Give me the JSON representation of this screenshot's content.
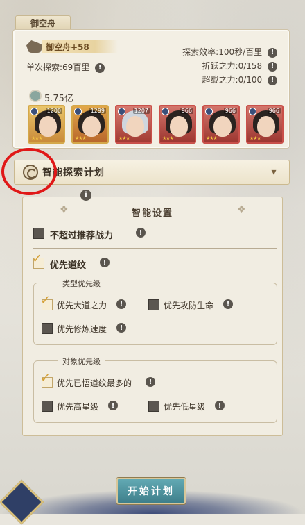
{
  "panel": {
    "title": "御空舟",
    "ship_name": "御空舟+58",
    "single_explore": "单次探索:69百里",
    "stats": [
      "探索效率:100秒/百里",
      "折跃之力:0/158",
      "超载之力:0/100"
    ],
    "power": "5.75亿"
  },
  "heroes": [
    {
      "level": "1200",
      "frame": "gold"
    },
    {
      "level": "1299",
      "frame": "gold"
    },
    {
      "level": "1207",
      "frame": "red"
    },
    {
      "level": "966",
      "frame": "red"
    },
    {
      "level": "966",
      "frame": "red"
    },
    {
      "level": "966",
      "frame": "red"
    }
  ],
  "plan": {
    "title": "智能探索计划"
  },
  "settings": {
    "title": "智能设置",
    "no_exceed": "不超过推荐战力",
    "prioritize_dao": "优先道纹",
    "type_group": {
      "title": "类型优先级",
      "opt_dao_power": "优先大道之力",
      "opt_attack_def": "优先攻防生命",
      "opt_cultivate": "优先修炼速度"
    },
    "target_group": {
      "title": "对象优先级",
      "opt_most_dao": "优先已悟道纹最多的",
      "opt_high_star": "优先高星级",
      "opt_low_star": "优先低星级"
    }
  },
  "start_button": "开始计划",
  "info_glyph": "!",
  "tip_glyph": "i",
  "check_glyph": "✓",
  "chevron_glyph": "▾",
  "deco_glyph": "❖",
  "stars_glyph": "★★★",
  "colors": {
    "accent_gold": "#d4a037",
    "button_teal": "#4f939e",
    "highlight_red": "#e01818"
  }
}
